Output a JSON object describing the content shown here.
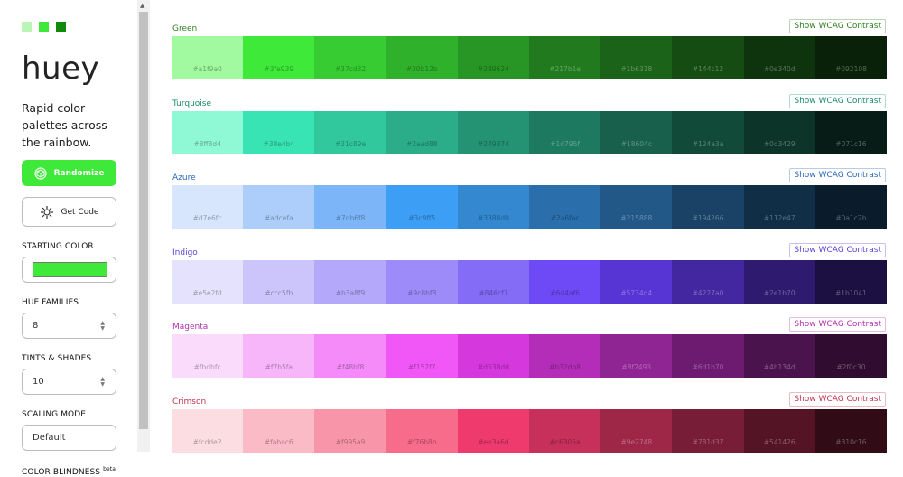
{
  "sidebar": {
    "swatches": [
      "#b9f6b6",
      "#3fe939",
      "#0f8a0c"
    ],
    "logo": "huey",
    "tagline": "Rapid color palettes across the rainbow.",
    "randomize_label": "Randomize",
    "get_code_label": "Get Code",
    "starting_color_label": "STARTING COLOR",
    "starting_color": "#3fe939",
    "hue_families_label": "HUE FAMILIES",
    "hue_families_value": "8",
    "tints_label": "TINTS & SHADES",
    "tints_value": "10",
    "scaling_label": "SCALING MODE",
    "scaling_value": "Default",
    "color_blindness_label": "COLOR BLINDNESS",
    "beta_label": "beta"
  },
  "wcag_label": "Show WCAG Contrast",
  "families": [
    {
      "name": "Green",
      "accent": "#2f7d1e",
      "colors": [
        "#a1f9a0",
        "#3fe939",
        "#37cd32",
        "#30b12b",
        "#289624",
        "#217b1e",
        "#1b6318",
        "#144c12",
        "#0e340d",
        "#092108"
      ]
    },
    {
      "name": "Turquoise",
      "accent": "#1a8a6a",
      "colors": [
        "#8ff8d4",
        "#38e4b4",
        "#31c89e",
        "#2aad88",
        "#249374",
        "#1d795f",
        "#18604c",
        "#124a3a",
        "#0d3429",
        "#071c16"
      ]
    },
    {
      "name": "Azure",
      "accent": "#2b66b5",
      "colors": [
        "#d7e6fc",
        "#adcefa",
        "#7db6f8",
        "#3c9ff5",
        "#3388d0",
        "#2a6fac",
        "#215888",
        "#194266",
        "#112e47",
        "#0a1c2b"
      ]
    },
    {
      "name": "Indigo",
      "accent": "#5b3fd6",
      "colors": [
        "#e5e2fd",
        "#ccc5fb",
        "#b3a8f9",
        "#9c8bf8",
        "#846cf7",
        "#6d4af6",
        "#5734d4",
        "#4227a0",
        "#2e1b70",
        "#1b1041"
      ]
    },
    {
      "name": "Magenta",
      "accent": "#b12fb0",
      "colors": [
        "#fbdbfc",
        "#f7b5fa",
        "#f48bf8",
        "#f157f7",
        "#d538dd",
        "#b32db8",
        "#8f2493",
        "#6d1b70",
        "#4b134d",
        "#2f0c30"
      ]
    },
    {
      "name": "Crimson",
      "accent": "#c2334f",
      "colors": [
        "#fcdde2",
        "#fabac6",
        "#f995a9",
        "#f76b8b",
        "#ee3a6d",
        "#c6305a",
        "#9e2748",
        "#781d37",
        "#541426",
        "#310c16"
      ]
    }
  ]
}
